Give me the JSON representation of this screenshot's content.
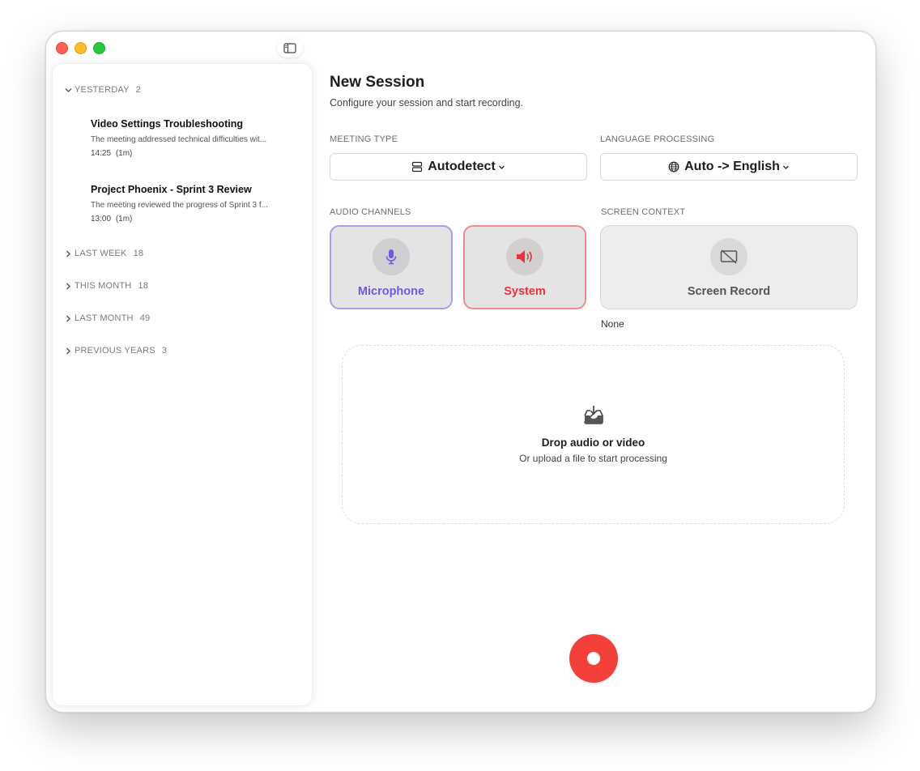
{
  "sidebar": {
    "groups": [
      {
        "label": "YESTERDAY",
        "count": "2",
        "expanded": true
      },
      {
        "label": "LAST WEEK",
        "count": "18",
        "expanded": false
      },
      {
        "label": "THIS MONTH",
        "count": "18",
        "expanded": false
      },
      {
        "label": "LAST MONTH",
        "count": "49",
        "expanded": false
      },
      {
        "label": "PREVIOUS YEARS",
        "count": "3",
        "expanded": false
      }
    ],
    "sessions": [
      {
        "title": "Video Settings Troubleshooting",
        "summary": "The meeting addressed technical difficulties wit...",
        "time": "14:25",
        "duration": "(1m)"
      },
      {
        "title": "Project Phoenix - Sprint 3 Review",
        "summary": "The meeting reviewed the progress of Sprint 3 f...",
        "time": "13:00",
        "duration": "(1m)"
      }
    ]
  },
  "main": {
    "title": "New Session",
    "subtitle": "Configure your session and start recording.",
    "meeting_type": {
      "label": "MEETING TYPE",
      "value": "Autodetect"
    },
    "language": {
      "label": "LANGUAGE PROCESSING",
      "value": "Auto -> English"
    },
    "audio_channels": {
      "label": "AUDIO CHANNELS",
      "microphone": "Microphone",
      "system": "System"
    },
    "screen_context": {
      "label": "SCREEN CONTEXT",
      "button": "Screen Record",
      "value": "None"
    },
    "dropzone": {
      "title": "Drop audio or video",
      "subtitle": "Or upload a file to start processing"
    }
  },
  "colors": {
    "accent_mic": "#7058e0",
    "accent_system": "#e8323e",
    "record": "#f4403a"
  },
  "icons": {
    "sidebar_toggle": "sidebar-toggle-icon",
    "meeting_type": "stack-icon",
    "language": "globe-icon",
    "microphone": "microphone-icon",
    "system": "speaker-icon",
    "screen": "screen-off-icon",
    "upload": "tray-upload-icon"
  }
}
